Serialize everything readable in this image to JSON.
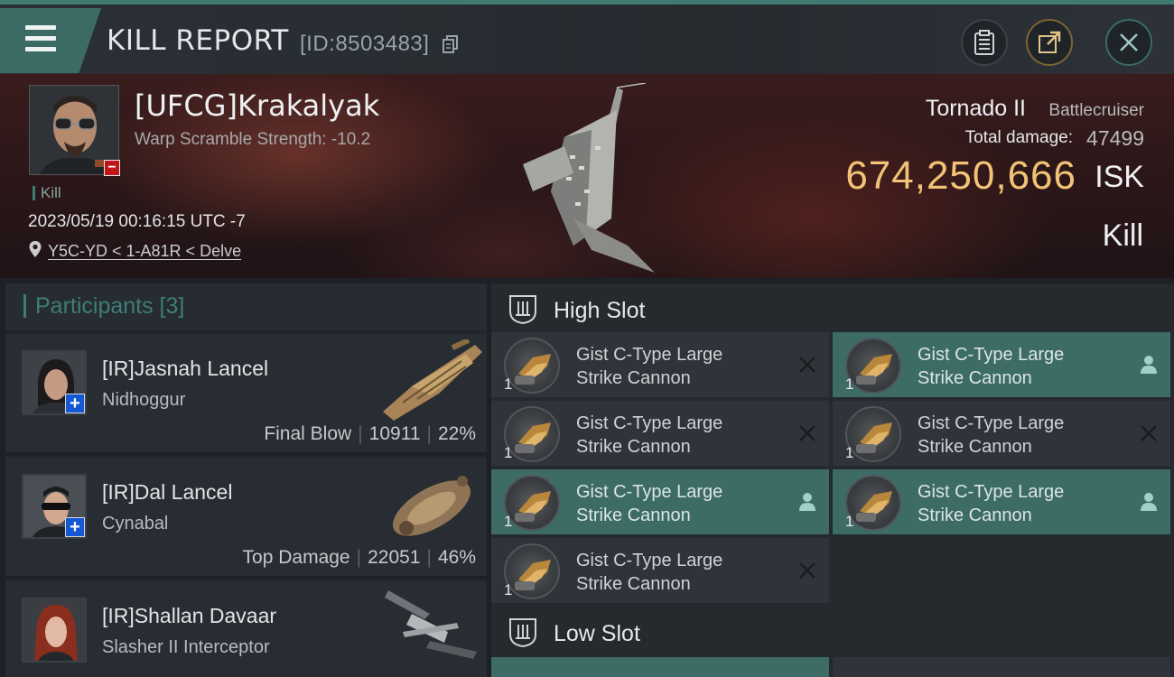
{
  "header": {
    "title": "KILL REPORT",
    "report_id": "[ID:8503483]",
    "menu_icon": "hamburger-menu-icon",
    "actions": [
      "clipboard-icon",
      "share-icon",
      "close-icon"
    ]
  },
  "victim": {
    "name": "[UFCG]Krakalyak",
    "subtitle": "Warp Scramble Strength: -10.2",
    "tag": "Kill",
    "datetime": "2023/05/19 00:16:15 UTC -7",
    "location": "Y5C-YD < 1-A81R < Delve",
    "ship_name": "Tornado II",
    "ship_class": "Battlecruiser",
    "total_damage_label": "Total damage:",
    "total_damage": "47499",
    "isk_value": "674,250,666",
    "isk_unit": "ISK",
    "result": "Kill"
  },
  "participants": {
    "title": "Participants [3]",
    "items": [
      {
        "name": "[IR]Jasnah Lancel",
        "ship": "Nidhoggur",
        "role": "Final Blow",
        "damage": "10911",
        "percent": "22%"
      },
      {
        "name": "[IR]Dal Lancel",
        "ship": "Cynabal",
        "role": "Top Damage",
        "damage": "22051",
        "percent": "46%"
      },
      {
        "name": "[IR]Shallan Davaar",
        "ship": "Slasher II Interceptor",
        "role": "",
        "damage": "",
        "percent": ""
      }
    ]
  },
  "slots": {
    "high": {
      "label": "High Slot",
      "modules": [
        {
          "qty": "1",
          "line1": "Gist C-Type Large",
          "line2": "Strike Cannon",
          "status": "destroyed"
        },
        {
          "qty": "1",
          "line1": "Gist C-Type Large",
          "line2": "Strike Cannon",
          "status": "dropped"
        },
        {
          "qty": "1",
          "line1": "Gist C-Type Large",
          "line2": "Strike Cannon",
          "status": "destroyed"
        },
        {
          "qty": "1",
          "line1": "Gist C-Type Large",
          "line2": "Strike Cannon",
          "status": "destroyed"
        },
        {
          "qty": "1",
          "line1": "Gist C-Type Large",
          "line2": "Strike Cannon",
          "status": "dropped"
        },
        {
          "qty": "1",
          "line1": "Gist C-Type Large",
          "line2": "Strike Cannon",
          "status": "dropped"
        },
        {
          "qty": "1",
          "line1": "Gist C-Type Large",
          "line2": "Strike Cannon",
          "status": "destroyed"
        }
      ]
    },
    "low": {
      "label": "Low Slot"
    }
  },
  "colors": {
    "accent": "#3f7a73",
    "isk": "#f2c376",
    "danger": "#c0161a",
    "corp_badge": "#1458d6"
  }
}
